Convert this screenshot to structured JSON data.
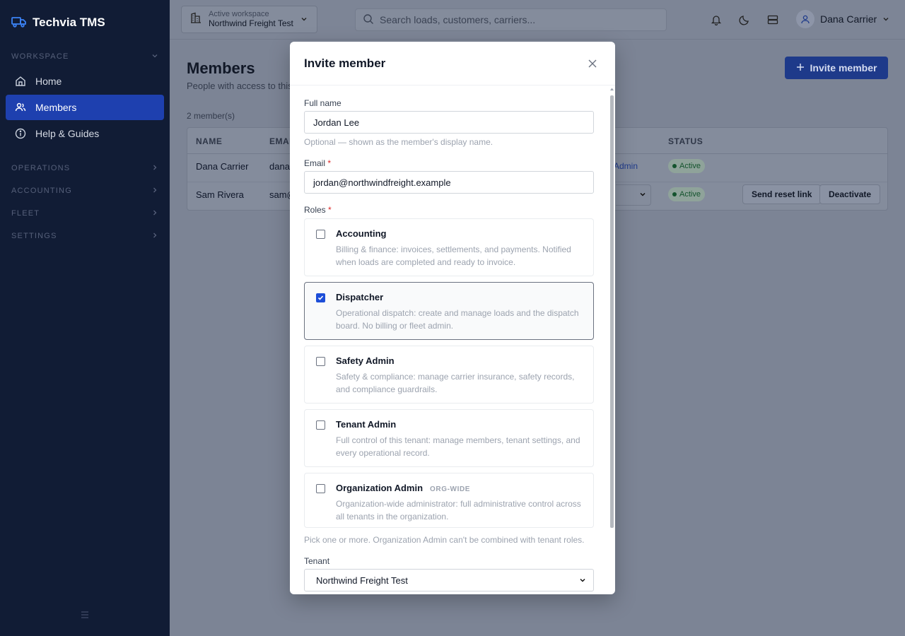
{
  "brand": {
    "name": "Techvia TMS"
  },
  "sidebar": {
    "workspace_label": "WORKSPACE",
    "items": [
      {
        "label": "Home",
        "icon": "home-icon"
      },
      {
        "label": "Members",
        "icon": "users-icon"
      },
      {
        "label": "Help & Guides",
        "icon": "info-icon"
      }
    ],
    "sections": [
      "OPERATIONS",
      "ACCOUNTING",
      "FLEET",
      "SETTINGS"
    ]
  },
  "topbar": {
    "workspace_small": "Active workspace",
    "workspace_name": "Northwind Freight Test",
    "search_placeholder": "Search loads, customers, carriers...",
    "user_name": "Dana Carrier"
  },
  "main": {
    "title": "Members",
    "subtitle": "People with access to this",
    "invite_button": "Invite member",
    "count": "2 member(s)",
    "columns": [
      "NAME",
      "EMAI",
      "STATUS"
    ],
    "rows": [
      {
        "name": "Dana Carrier",
        "email": "dana",
        "role": "Admin",
        "status": "Active"
      },
      {
        "name": "Sam Rivera",
        "email": "sam@",
        "status": "Active",
        "reset": "Send reset link",
        "deactivate": "Deactivate"
      }
    ]
  },
  "modal": {
    "title": "Invite member",
    "full_name_label": "Full name",
    "full_name_value": "Jordan Lee",
    "full_name_help": "Optional — shown as the member's display name.",
    "email_label": "Email",
    "email_value": "jordan@northwindfreight.example",
    "roles_label": "Roles",
    "required_mark": "*",
    "roles": [
      {
        "name": "Accounting",
        "tag": "",
        "checked": false,
        "desc": "Billing & finance: invoices, settlements, and payments. Notified when loads are completed and ready to invoice."
      },
      {
        "name": "Dispatcher",
        "tag": "",
        "checked": true,
        "desc": "Operational dispatch: create and manage loads and the dispatch board. No billing or fleet admin."
      },
      {
        "name": "Safety Admin",
        "tag": "",
        "checked": false,
        "desc": "Safety & compliance: manage carrier insurance, safety records, and compliance guardrails."
      },
      {
        "name": "Tenant Admin",
        "tag": "",
        "checked": false,
        "desc": "Full control of this tenant: manage members, tenant settings, and every operational record."
      },
      {
        "name": "Organization Admin",
        "tag": "ORG-WIDE",
        "checked": false,
        "desc": "Organization-wide administrator: full administrative control across all tenants in the organization."
      }
    ],
    "roles_help": "Pick one or more. Organization Admin can't be combined with tenant roles.",
    "tenant_label": "Tenant",
    "tenant_value": "Northwind Freight Test"
  },
  "colors": {
    "accent": "#1d4ed8",
    "sidebar": "#111c35",
    "active_nav": "#1e40af"
  }
}
